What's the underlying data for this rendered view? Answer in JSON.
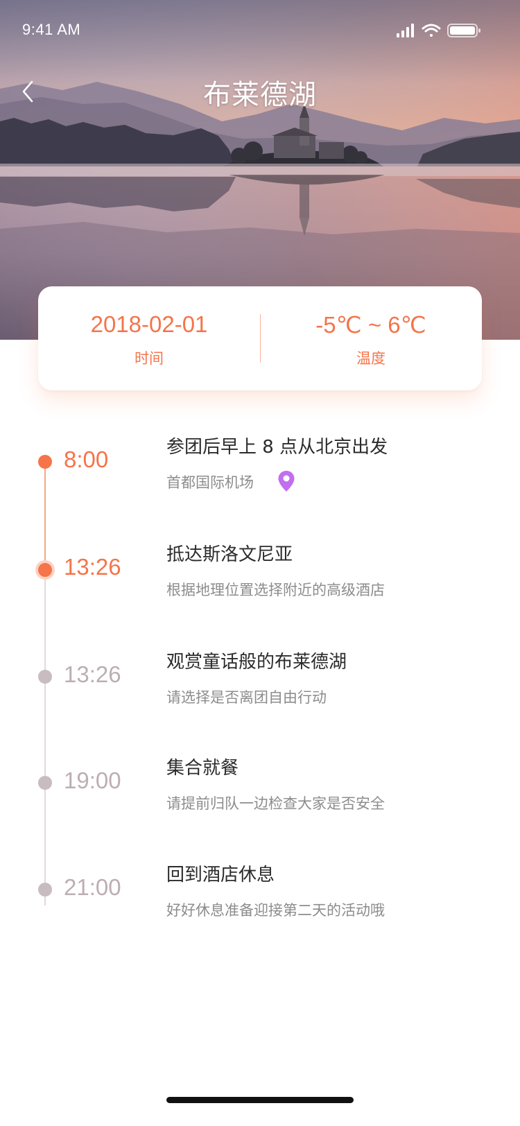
{
  "status_bar": {
    "time": "9:41 AM",
    "icons": [
      "signal-icon",
      "wifi-icon",
      "battery-icon"
    ]
  },
  "nav": {
    "back_icon": "chevron-left-icon",
    "title": "布莱德湖"
  },
  "info": {
    "date_value": "2018-02-01",
    "date_label": "时间",
    "temp_value": "-5℃ ~ 6℃",
    "temp_label": "温度"
  },
  "timeline": [
    {
      "time": "8:00",
      "title": "参团后早上 8 点从北京出发",
      "subtitle": "首都国际机场",
      "state": "done",
      "has_location_pin": true
    },
    {
      "time": "13:26",
      "title": "抵达斯洛文尼亚",
      "subtitle": "根据地理位置选择附近的高级酒店",
      "state": "current",
      "has_location_pin": false
    },
    {
      "time": "13:26",
      "title": "观赏童话般的布莱德湖",
      "subtitle": "请选择是否离团自由行动",
      "state": "upcoming",
      "has_location_pin": false
    },
    {
      "time": "19:00",
      "title": "集合就餐",
      "subtitle": "请提前归队一边检查大家是否安全",
      "state": "upcoming",
      "has_location_pin": false
    },
    {
      "time": "21:00",
      "title": "回到酒店休息",
      "subtitle": "好好休息准备迎接第二天的活动哦",
      "state": "upcoming",
      "has_location_pin": false
    }
  ],
  "colors": {
    "accent": "#f5744a",
    "inactive_dot": "#c8bcc0",
    "title_text": "#2b2b2b",
    "sub_text": "#8c8c8c",
    "location_pin": "#c26ef0"
  }
}
